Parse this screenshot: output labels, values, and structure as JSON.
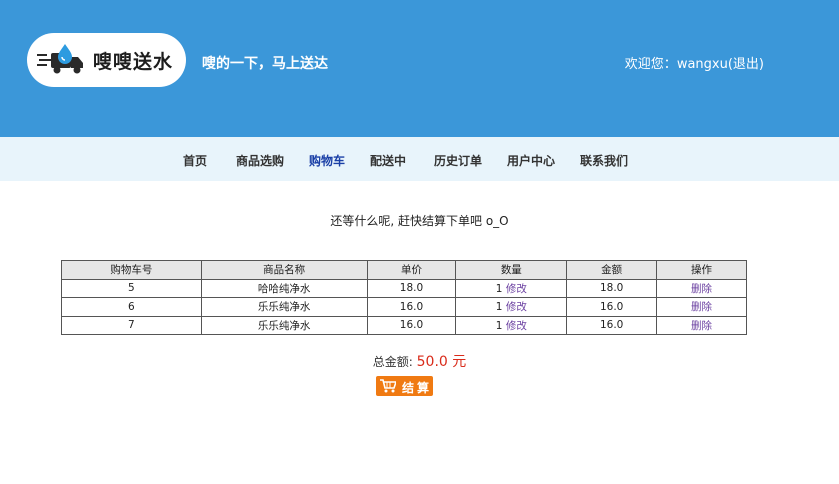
{
  "header": {
    "brand": "嗖嗖送水",
    "slogan": "嗖的一下，马上送达",
    "welcome_prefix": "欢迎您：",
    "username": "wangxu",
    "logout": "(退出)"
  },
  "nav": {
    "items": [
      "首页",
      "商品选购",
      "购物车",
      "配送中",
      "历史订单",
      "用户中心",
      "联系我们"
    ],
    "active": "购物车"
  },
  "prompt": "还等什么呢, 赶快结算下单吧 o_O",
  "cart": {
    "columns": [
      "购物车号",
      "商品名称",
      "单价",
      "数量",
      "金额",
      "操作"
    ],
    "rows": [
      {
        "id": "5",
        "name": "哈哈纯净水",
        "price": "18.0",
        "qty": "1",
        "edit": "修改",
        "amount": "18.0",
        "delete": "删除"
      },
      {
        "id": "6",
        "name": "乐乐纯净水",
        "price": "16.0",
        "qty": "1",
        "edit": "修改",
        "amount": "16.0",
        "delete": "删除"
      },
      {
        "id": "7",
        "name": "乐乐纯净水",
        "price": "16.0",
        "qty": "1",
        "edit": "修改",
        "amount": "16.0",
        "delete": "删除"
      }
    ]
  },
  "total": {
    "label": "总金额:",
    "amount": "50.0 元"
  },
  "checkout_label": "结算",
  "colors": {
    "header": "#3b97d9",
    "nav": "#e8f4fb",
    "accent": "#f07a12",
    "amount": "#d92b1a"
  }
}
